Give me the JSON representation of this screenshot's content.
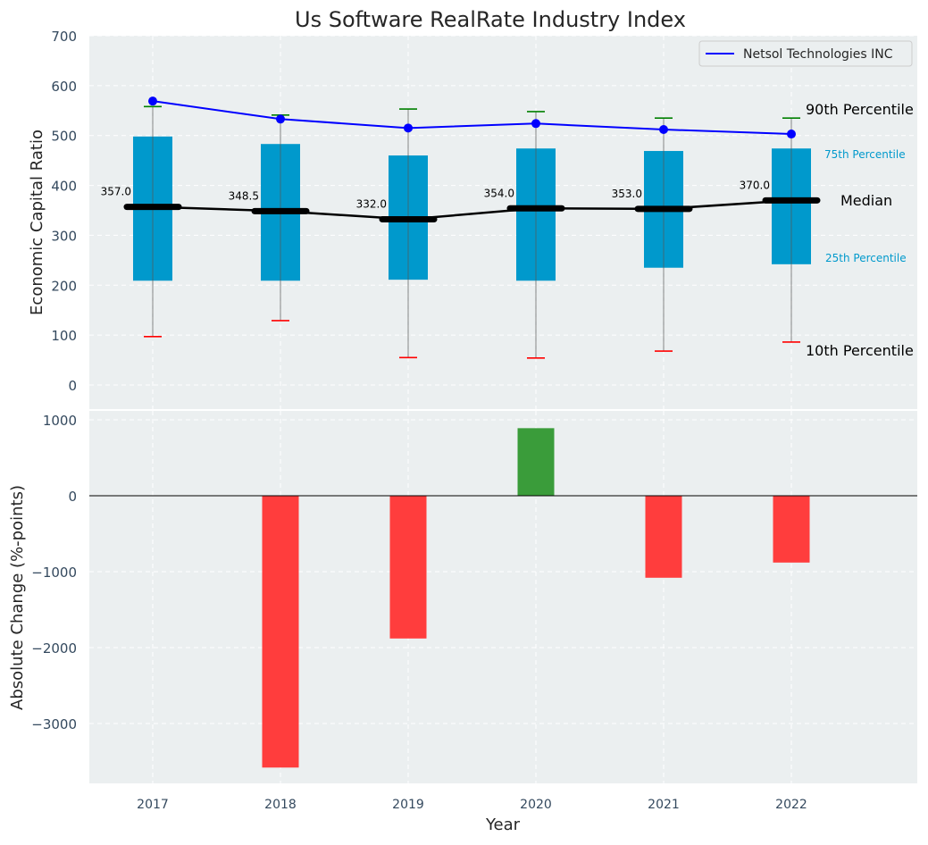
{
  "title": "Us Software RealRate Industry Index",
  "chart_data": [
    {
      "type": "box",
      "ylabel": "Economic Capital Ratio",
      "ylim": [
        0,
        700
      ],
      "yticks": [
        0,
        100,
        200,
        300,
        400,
        500,
        600,
        700
      ],
      "categories": [
        "2017",
        "2018",
        "2019",
        "2020",
        "2021",
        "2022"
      ],
      "p10": [
        97,
        129,
        55,
        54,
        68,
        86
      ],
      "p25": [
        209,
        209,
        211,
        209,
        235,
        242
      ],
      "median": [
        357.0,
        348.5,
        332.0,
        354.0,
        353.0,
        370.0
      ],
      "median_labels": [
        "357.0",
        "348.5",
        "332.0",
        "354.0",
        "353.0",
        "370.0"
      ],
      "p75": [
        498,
        483,
        460,
        474,
        469,
        474
      ],
      "p90": [
        558,
        541,
        553,
        548,
        535,
        535
      ],
      "series": [
        {
          "name": "Netsol Technologies INC",
          "values": [
            569,
            533,
            515,
            524,
            512,
            503
          ],
          "color": "#0000ff"
        }
      ],
      "annotations": {
        "p90": "90th Percentile",
        "p75": "75th Percentile",
        "median": "Median",
        "p25": "25th Percentile",
        "p10": "10th Percentile"
      },
      "colors": {
        "box": "#0099cc",
        "median": "#000000",
        "p90_cap": "#008000",
        "p10_cap": "#ff0000",
        "background": "#ebeff0"
      },
      "grid": true,
      "legend": "top-right"
    },
    {
      "type": "bar",
      "xlabel": "Year",
      "ylabel": "Absolute Change (%-points)",
      "ylim": [
        -3788,
        1118
      ],
      "yticks": [
        -3000,
        -2000,
        -1000,
        0,
        1000
      ],
      "ytick_labels": [
        "−3000",
        "−2000",
        "−1000",
        "0",
        "1000"
      ],
      "categories": [
        "2017",
        "2018",
        "2019",
        "2020",
        "2021",
        "2022"
      ],
      "values": [
        null,
        -3580,
        -1880,
        890,
        -1080,
        -880
      ],
      "colors": {
        "positive": "#3a9c3a",
        "negative": "#ff3d3d"
      },
      "grid": true
    }
  ]
}
